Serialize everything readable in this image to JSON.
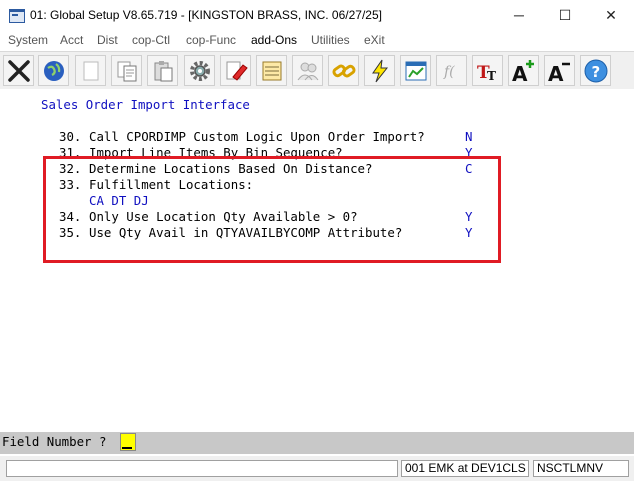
{
  "window": {
    "title": "01: Global Setup V8.65.719 - [KINGSTON BRASS, INC. 06/27/25]",
    "minimize_glyph": "─",
    "maximize_glyph": "☐",
    "close_glyph": "✕"
  },
  "menu": {
    "items": [
      "System",
      "Acct",
      "Dist",
      "cop-Ctl",
      "cop-Func",
      "add-Ons",
      "Utilities",
      "eXit"
    ],
    "active_item": "add-Ons"
  },
  "toolbar": {
    "buttons": [
      "exit-icon",
      "globe-icon",
      "blank-page-icon",
      "copy-icon",
      "paste-icon",
      "gear-icon",
      "eraser-icon",
      "notepad-icon",
      "users-icon",
      "link-icon",
      "lightning-icon",
      "chart-window-icon",
      "function-icon",
      "font-style-icon",
      "font-increase-icon",
      "font-decrease-icon",
      "help-icon"
    ]
  },
  "screen": {
    "heading": "Sales Order Import Interface",
    "fields": [
      {
        "num": "30.",
        "label": "Call CPORDIMP Custom Logic Upon Order Import?",
        "value": "N"
      },
      {
        "num": "31.",
        "label": "Import Line Items By Bin Sequence?",
        "value": "Y"
      },
      {
        "num": "32.",
        "label": "Determine Locations Based On Distance?",
        "value": "C"
      },
      {
        "num": "33.",
        "label": "Fulfillment Locations:",
        "value": ""
      },
      {
        "num": "34.",
        "label": "Only Use Location Qty Available > 0?",
        "value": "Y"
      },
      {
        "num": "35.",
        "label": "Use Qty Avail in QTYAVAILBYCOMP Attribute?",
        "value": "Y"
      }
    ],
    "fulfillment_locations": "CA DT DJ"
  },
  "prompt": {
    "label": "Field Number ?",
    "value": ""
  },
  "status": {
    "user": "001 EMK at DEV1CLS",
    "program": "NSCTLMNV"
  },
  "colors": {
    "value_text": "#1010c0",
    "highlight_box": "#e01b24",
    "cursor": "#ffff00"
  }
}
